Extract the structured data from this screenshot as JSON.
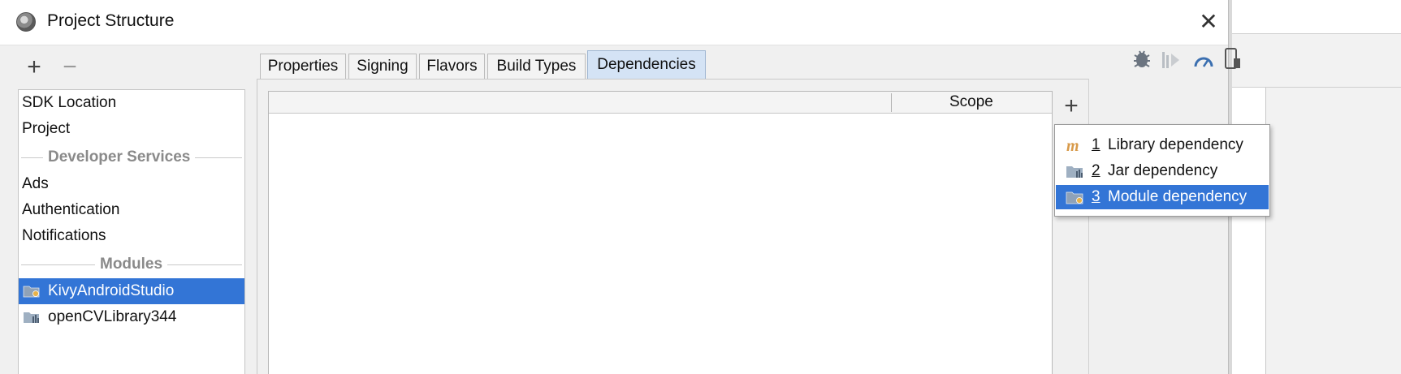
{
  "window": {
    "title": "Project Structure",
    "close_glyph": "✕"
  },
  "sidebar": {
    "toolbar": {
      "add_glyph": "+",
      "remove_glyph": "−"
    },
    "items": [
      {
        "label": "SDK Location"
      },
      {
        "label": "Project"
      }
    ],
    "sections": [
      {
        "label": "Developer Services",
        "items": [
          {
            "label": "Ads"
          },
          {
            "label": "Authentication"
          },
          {
            "label": "Notifications"
          }
        ]
      },
      {
        "label": "Modules",
        "items": [
          {
            "label": "KivyAndroidStudio",
            "icon": "module-folder-icon",
            "selected": true
          },
          {
            "label": "openCVLibrary344",
            "icon": "library-folder-icon",
            "selected": false
          }
        ]
      }
    ]
  },
  "tabs": [
    {
      "label": "Properties"
    },
    {
      "label": "Signing"
    },
    {
      "label": "Flavors"
    },
    {
      "label": "Build Types"
    },
    {
      "label": "Dependencies",
      "active": true
    }
  ],
  "dependencies_table": {
    "columns": [
      "",
      "Scope"
    ],
    "rows": [],
    "add_glyph": "+"
  },
  "add_dependency_menu": [
    {
      "number": "1",
      "label": "Library dependency",
      "icon": "maven-icon"
    },
    {
      "number": "2",
      "label": "Jar dependency",
      "icon": "jar-folder-icon"
    },
    {
      "number": "3",
      "label": "Module dependency",
      "icon": "module-folder-icon",
      "selected": true
    }
  ],
  "colors": {
    "selection": "#3375d6",
    "active_tab": "#d4e3f5",
    "maven_icon": "#d89a4a"
  }
}
